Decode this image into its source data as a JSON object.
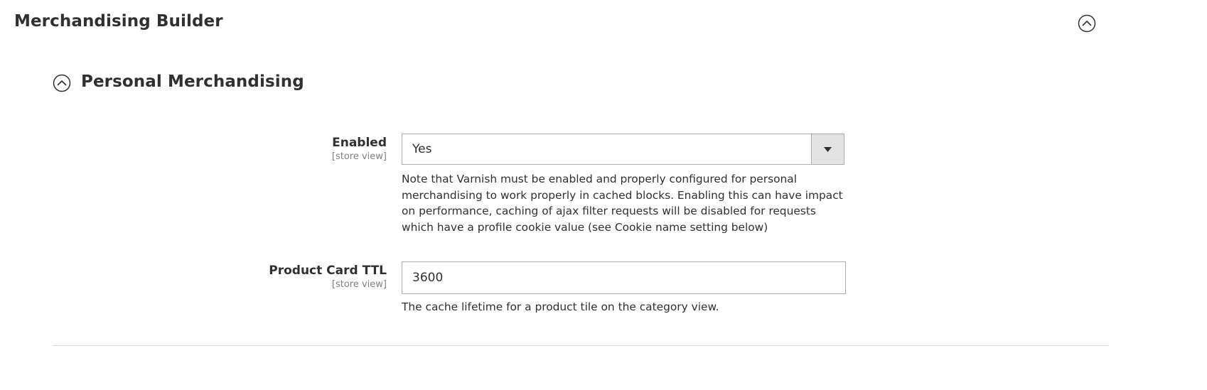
{
  "section": {
    "title": "Merchandising Builder",
    "collapse_icon": "chevron-up-circle-icon"
  },
  "subsection": {
    "title": "Personal Merchandising",
    "toggle_icon": "chevron-up-circle-icon"
  },
  "fields": {
    "enabled": {
      "label": "Enabled",
      "scope": "[store view]",
      "value": "Yes",
      "note_lines": [
        "Note that Varnish must be enabled and properly configured for personal",
        "merchandising to work properly in cached blocks. Enabling this can have impact",
        "on performance, caching of ajax filter requests will be disabled for requests",
        "which have a profile cookie value (see Cookie name setting below)"
      ]
    },
    "product_card_ttl": {
      "label": "Product Card TTL",
      "scope": "[store view]",
      "value": "3600",
      "note": "The cache lifetime for a product tile on the category view."
    }
  },
  "colors": {
    "text": "#303030",
    "scope": "#808080",
    "border": "#adadad",
    "select_button_bg": "#e3e3e3",
    "divider": "#d9d9d9"
  }
}
